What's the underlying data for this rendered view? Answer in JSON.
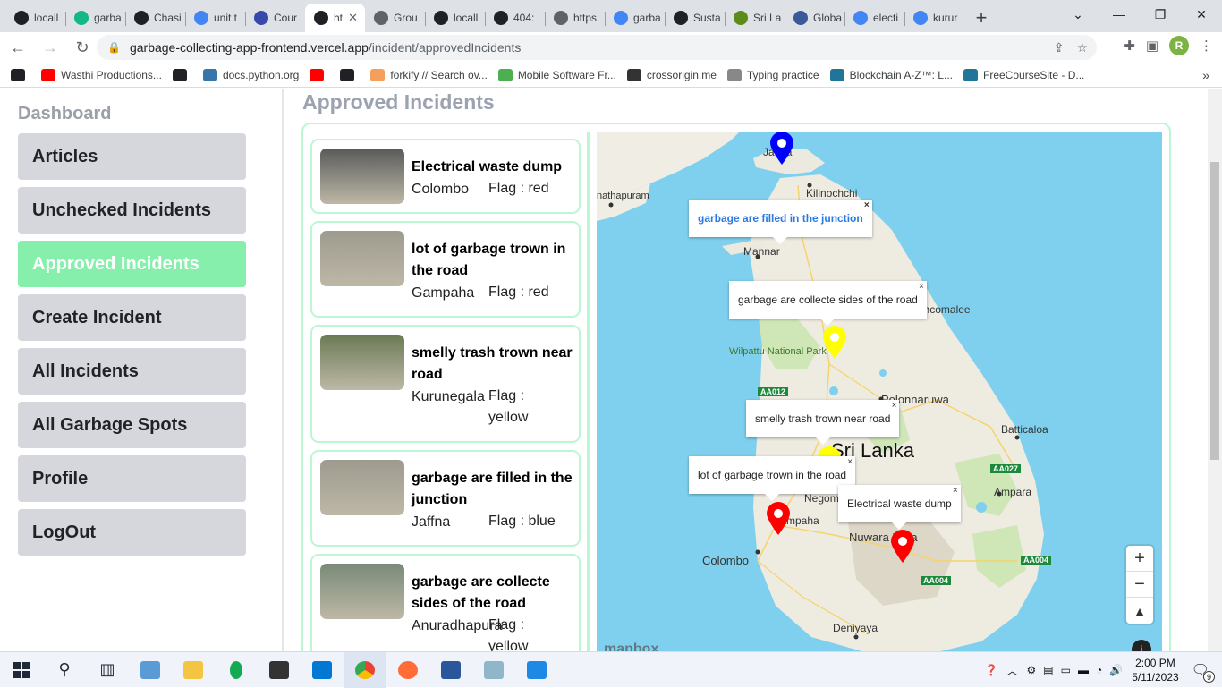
{
  "browser": {
    "tabs": [
      {
        "label": "locall",
        "icon": "globe-icon",
        "color": "#202124",
        "active": false
      },
      {
        "label": "garba",
        "icon": "app-icon",
        "color": "#12b886",
        "active": false
      },
      {
        "label": "Chasi",
        "icon": "github-icon",
        "color": "#202124",
        "active": false
      },
      {
        "label": "unit t",
        "icon": "google-icon",
        "color": "#4285f4",
        "active": false
      },
      {
        "label": "Cour",
        "icon": "shield-icon",
        "color": "#3949ab",
        "active": false
      },
      {
        "label": "ht",
        "icon": "globe-icon",
        "color": "#202124",
        "active": true
      },
      {
        "label": "Grou",
        "icon": "globe-icon",
        "color": "#5f6368",
        "active": false
      },
      {
        "label": "locall",
        "icon": "globe-icon",
        "color": "#202124",
        "active": false
      },
      {
        "label": "404:",
        "icon": "globe-icon",
        "color": "#202124",
        "active": false
      },
      {
        "label": "https",
        "icon": "globe-icon",
        "color": "#5f6368",
        "active": false
      },
      {
        "label": "garba",
        "icon": "google-icon",
        "color": "#4285f4",
        "active": false
      },
      {
        "label": "Susta",
        "icon": "wikipedia-icon",
        "color": "#202124",
        "active": false
      },
      {
        "label": "Sri La",
        "icon": "m-icon",
        "color": "#5b8c1a",
        "active": false
      },
      {
        "label": "Globa",
        "icon": "shield-icon",
        "color": "#3b5998",
        "active": false
      },
      {
        "label": "electi",
        "icon": "google-icon",
        "color": "#4285f4",
        "active": false
      },
      {
        "label": "kurur",
        "icon": "google-icon",
        "color": "#4285f4",
        "active": false
      }
    ],
    "url_host": "garbage-collecting-app-frontend.vercel.app",
    "url_path": "/incident/approvedIncidents",
    "avatar_letter": "R",
    "bookmarks": [
      {
        "label": "",
        "color": "#202124"
      },
      {
        "label": "Wasthi Productions...",
        "color": "#ff0000"
      },
      {
        "label": "",
        "color": "#202124"
      },
      {
        "label": "docs.python.org",
        "color": "#3776ab"
      },
      {
        "label": "",
        "color": "#ff0000"
      },
      {
        "label": "",
        "color": "#202124"
      },
      {
        "label": "forkify // Search ov...",
        "color": "#f59f5b"
      },
      {
        "label": "Mobile Software Fr...",
        "color": "#4caf50"
      },
      {
        "label": "crossorigin.me",
        "color": "#333333"
      },
      {
        "label": "Typing practice",
        "color": "#888888"
      },
      {
        "label": "Blockchain A-Z™: L...",
        "color": "#21759b"
      },
      {
        "label": "FreeCourseSite - D...",
        "color": "#21759b"
      }
    ]
  },
  "sidebar": {
    "title": "Dashboard",
    "items": [
      {
        "label": "Articles",
        "active": false
      },
      {
        "label": "Unchecked Incidents",
        "active": false
      },
      {
        "label": "Approved Incidents",
        "active": true
      },
      {
        "label": "Create Incident",
        "active": false
      },
      {
        "label": "All Incidents",
        "active": false
      },
      {
        "label": "All Garbage Spots",
        "active": false
      },
      {
        "label": "Profile",
        "active": false
      },
      {
        "label": "LogOut",
        "active": false
      }
    ]
  },
  "main": {
    "title": "Approved Incidents",
    "incidents": [
      {
        "title": "Electrical waste dump",
        "location": "Colombo",
        "flag": "Flag : red",
        "thumb": "#5a5a5a"
      },
      {
        "title": "lot of garbage trown in the road",
        "location": "Gampaha",
        "flag": "Flag : red",
        "thumb": "#9e9a8e"
      },
      {
        "title": "smelly trash trown near road",
        "location": "Kurunegala",
        "flag": "Flag : yellow",
        "thumb": "#6b7a55"
      },
      {
        "title": "garbage are filled in the junction",
        "location": "Jaffna",
        "flag": "Flag : blue",
        "thumb": "#9e9a8e"
      },
      {
        "title": "garbage are collecte sides of the road",
        "location": "Anuradhapura",
        "flag": "Flag : yellow",
        "thumb": "#7a8a78"
      }
    ]
  },
  "map": {
    "place_labels": [
      "Jaffna",
      "Kilinochchi",
      "nathapuram",
      "Mannar",
      "Trincomalee",
      "Wilpattu National Park",
      "Polonnaruwa",
      "Batticaloa",
      "Sri Lanka",
      "Ampara",
      "Negombo",
      "Gampaha",
      "Colombo",
      "Nuwara Eliya",
      "Deniyaya"
    ],
    "road_labels": [
      "AA012",
      "AA027",
      "AA004",
      "AA004"
    ],
    "popups": [
      {
        "text": "garbage are filled in the junction",
        "style": "blue"
      },
      {
        "text": "garbage are collecte sides of the road",
        "style": "normal"
      },
      {
        "text": "smelly trash trown near road",
        "style": "normal"
      },
      {
        "text": "lot of garbage trown in the road",
        "style": "normal"
      },
      {
        "text": "Electrical waste dump",
        "style": "normal"
      }
    ],
    "close_glyph": "×",
    "zoom_in": "+",
    "zoom_out": "−",
    "attribution": "mapbox",
    "marker_colors": {
      "blue": "#0000ff",
      "yellow": "#ffff00",
      "red": "#ff0000"
    }
  },
  "taskbar": {
    "time": "2:00 PM",
    "date": "5/11/2023",
    "notification_count": "9"
  }
}
